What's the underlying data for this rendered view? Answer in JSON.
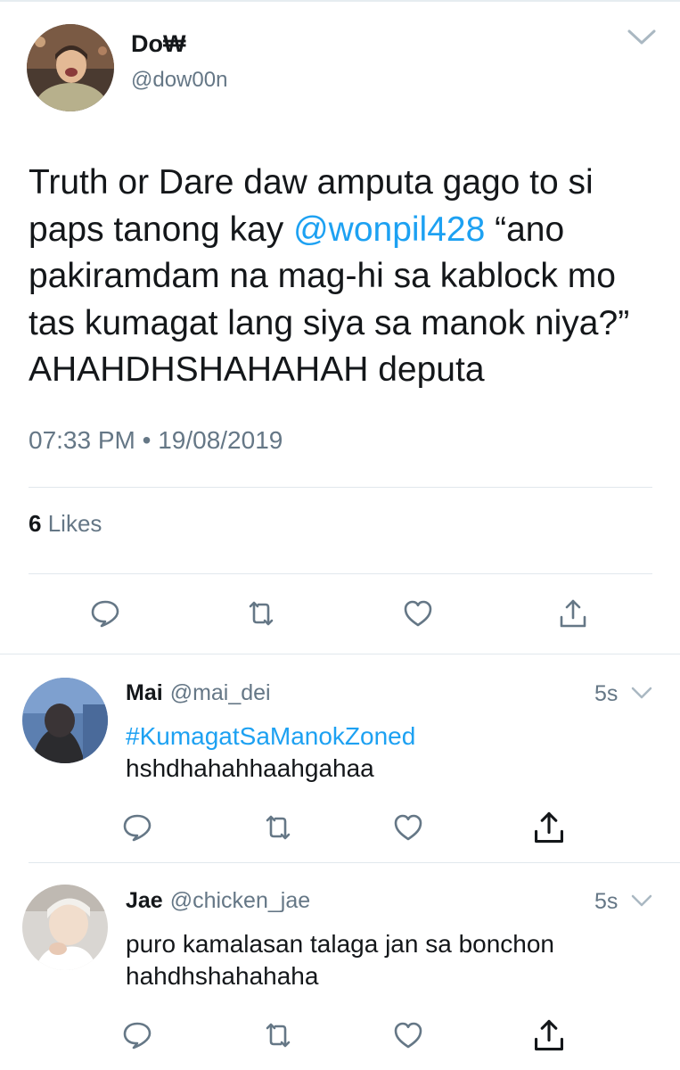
{
  "main_tweet": {
    "name": "Do₩",
    "handle": "@dow00n",
    "text_part1": "Truth or Dare daw amputa gago to si paps tanong kay ",
    "mention": "@wonpil428",
    "text_part2": " “ano pakiramdam na mag-hi sa kablock mo tas kumagat lang siya sa manok niya?” AHAHDHSHAHAHAH deputa",
    "timestamp": "07:33 PM • 19/08/2019",
    "likes_count": "6",
    "likes_label": "Likes"
  },
  "replies": [
    {
      "name": "Mai",
      "handle": "@mai_dei",
      "time": "5s",
      "hashtag": "#KumagatSaManokZoned",
      "text": "hshdhahahhaahgahaa"
    },
    {
      "name": "Jae",
      "handle": "@chicken_jae",
      "time": "5s",
      "text": "puro kamalasan talaga jan sa bonchon hahdhshahahaha"
    }
  ],
  "icons": {
    "reply": "reply-icon",
    "retweet": "retweet-icon",
    "like": "like-icon",
    "share": "share-icon",
    "more": "chevron-down-icon"
  },
  "colors": {
    "link": "#1da1f2",
    "secondary_text": "#657786",
    "icon_gray": "#657786",
    "primary_text": "#14171a",
    "divider": "#e1e8ed"
  }
}
